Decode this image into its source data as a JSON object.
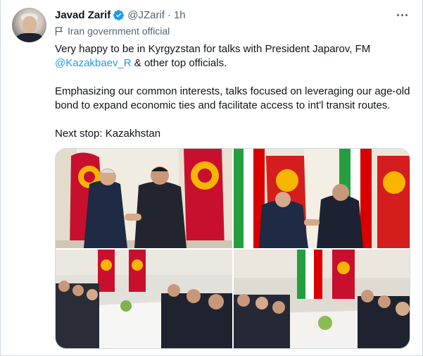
{
  "author": {
    "name": "Javad Zarif",
    "handle": "@JZarif",
    "separator": "·",
    "time": "1h",
    "label": "Iran government official"
  },
  "tweet": {
    "line1_before": "Very happy to be in Kyrgyzstan for talks with President Japarov, FM",
    "mention": "@Kazakbaev_R",
    "line1_after": " & other top officials.",
    "para2": "Emphasizing our common interests, talks focused on leveraging our age-old bond to expand economic ties and facilitate access to int'l transit routes.",
    "para3": "Next stop: Kazakhstan"
  },
  "colors": {
    "link": "#1d9bf0",
    "verified": "#1d9bf0",
    "secondary_text": "#536471"
  },
  "icons": [
    "verified-badge-icon",
    "more-options-icon",
    "government-flag-icon"
  ]
}
